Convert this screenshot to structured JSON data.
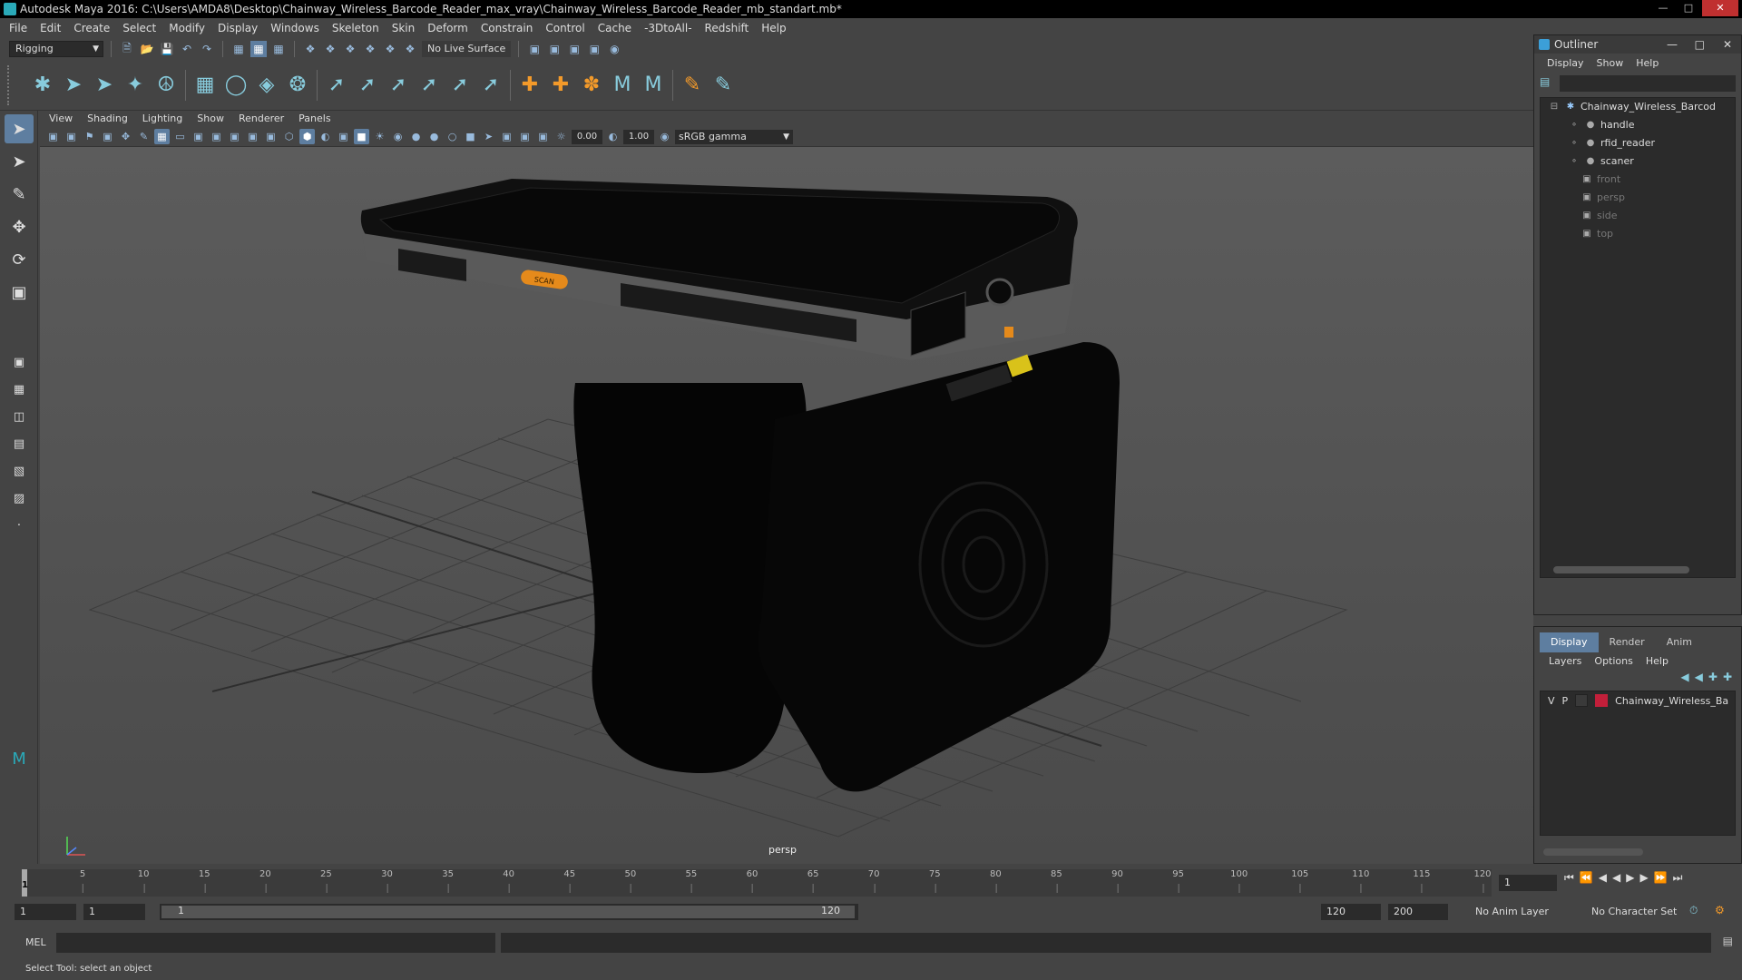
{
  "window": {
    "title": "Autodesk Maya 2016: C:\\Users\\AMDA8\\Desktop\\Chainway_Wireless_Barcode_Reader_max_vray\\Chainway_Wireless_Barcode_Reader_mb_standart.mb*"
  },
  "menubar": [
    "File",
    "Edit",
    "Create",
    "Select",
    "Modify",
    "Display",
    "Windows",
    "Skeleton",
    "Skin",
    "Deform",
    "Constrain",
    "Control",
    "Cache",
    "-3DtoAll-",
    "Redshift",
    "Help"
  ],
  "status_line": {
    "mode": "Rigging",
    "live_surface": "No Live Surface"
  },
  "viewport": {
    "menu": [
      "View",
      "Shading",
      "Lighting",
      "Show",
      "Renderer",
      "Panels"
    ],
    "near_value": "0.00",
    "far_value": "1.00",
    "color_space": "sRGB gamma",
    "camera_label": "persp",
    "device_button_label": "SCAN"
  },
  "outliner": {
    "title": "Outliner",
    "menu": [
      "Display",
      "Show",
      "Help"
    ],
    "items": [
      {
        "label": "Chainway_Wireless_Barcod",
        "dim": false
      },
      {
        "label": "handle",
        "dim": false
      },
      {
        "label": "rfid_reader",
        "dim": false
      },
      {
        "label": "scaner",
        "dim": false
      },
      {
        "label": "front",
        "dim": true
      },
      {
        "label": "persp",
        "dim": true
      },
      {
        "label": "side",
        "dim": true
      },
      {
        "label": "top",
        "dim": true
      }
    ]
  },
  "layers": {
    "tabs": [
      "Display",
      "Render",
      "Anim"
    ],
    "active_tab": "Display",
    "menu": [
      "Layers",
      "Options",
      "Help"
    ],
    "row": {
      "v": "V",
      "p": "P",
      "name": "Chainway_Wireless_Ba",
      "color": "#c21f3a"
    }
  },
  "timeline": {
    "ticks": [
      "5",
      "10",
      "15",
      "20",
      "25",
      "30",
      "35",
      "40",
      "45",
      "50",
      "55",
      "60",
      "65",
      "70",
      "75",
      "80",
      "85",
      "90",
      "95",
      "100",
      "105",
      "110",
      "115",
      "120"
    ],
    "current_frame": "1",
    "current_frame_field": "1"
  },
  "range": {
    "start": "1",
    "start2": "1",
    "slider_start": "1",
    "slider_end": "120",
    "end": "120",
    "end2": "200",
    "anim_layer": "No Anim Layer",
    "char_set": "No Character Set"
  },
  "command_line": {
    "label": "MEL"
  },
  "status_bar": {
    "help": "Select Tool: select an object"
  }
}
